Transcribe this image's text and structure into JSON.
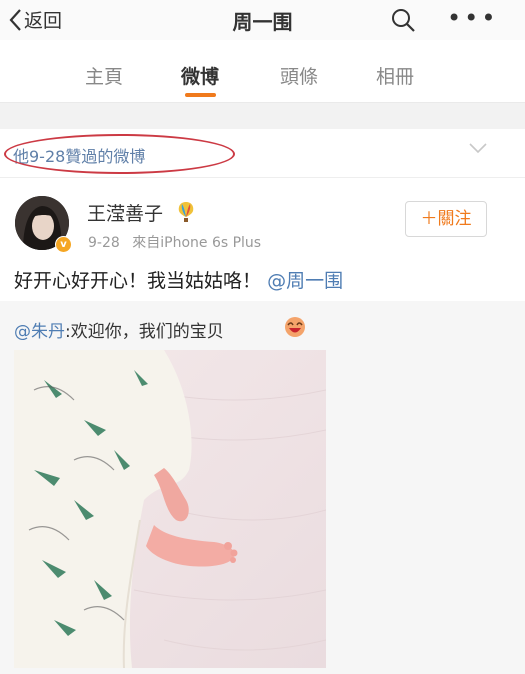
{
  "nav": {
    "back_label": "返回",
    "title": "周一围",
    "more_label": "•••"
  },
  "tabs": [
    "主頁",
    "微博",
    "頭條",
    "相冊"
  ],
  "active_tab": "微博",
  "liked": {
    "text": "他9-28贊過的微博"
  },
  "post": {
    "author": "王滢善子",
    "time": "9-28",
    "source": "來自iPhone 6s Plus",
    "follow_label": "＋關注",
    "text_main": "好开心好开心！我当姑姑咯！",
    "text_mention": "@周一围",
    "repost": {
      "mention": "@朱丹",
      "text": ":欢迎你，我们的宝贝"
    }
  },
  "colors": {
    "accent": "#f07a1c",
    "link": "#4f7db3",
    "annotation_circle": "#cc3a44"
  }
}
